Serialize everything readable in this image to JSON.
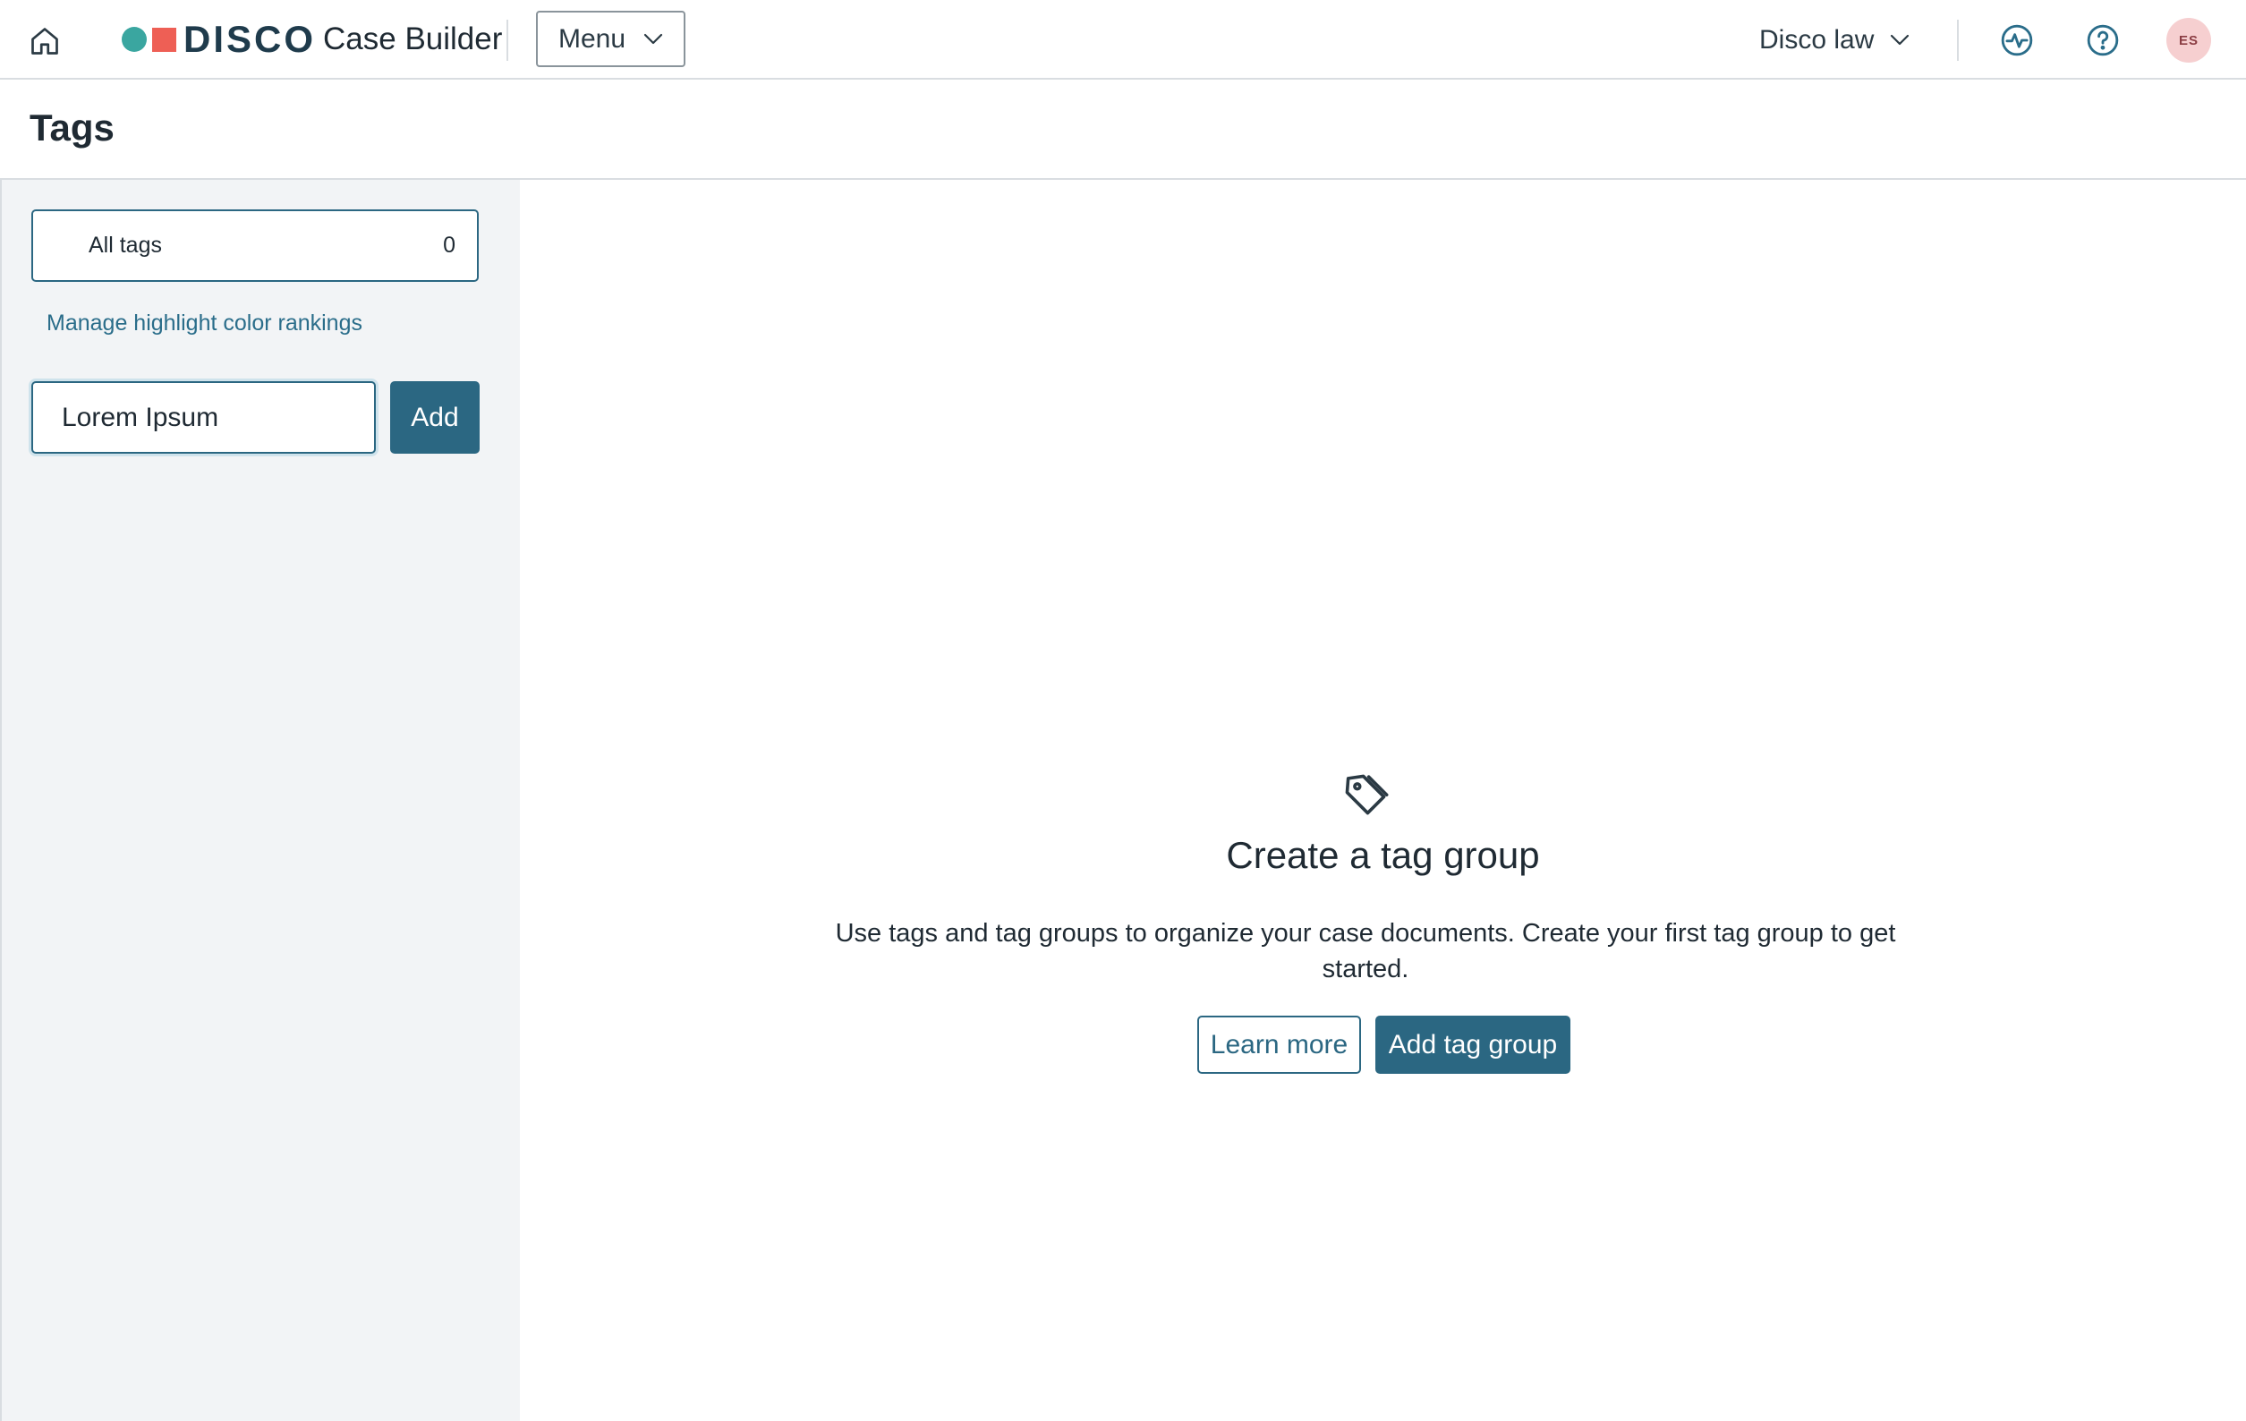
{
  "app": {
    "logo_word": "DISCO",
    "product_name": "Case Builder",
    "brand_colors": {
      "dot": "#3aa6a0",
      "square": "#ee5f55",
      "accent": "#2b6782"
    }
  },
  "topbar": {
    "home_icon": "home-icon",
    "menu_label": "Menu",
    "org_label": "Disco law",
    "activity_icon": "activity-icon",
    "help_icon": "help-icon",
    "avatar_initials": "ES"
  },
  "page": {
    "title": "Tags"
  },
  "sidebar": {
    "all_tags_label": "All tags",
    "all_tags_count": "0",
    "manage_link": "Manage highlight color rankings",
    "new_tag_value": "Lorem Ipsum",
    "add_label": "Add"
  },
  "empty_state": {
    "icon": "tag-icon",
    "title": "Create a tag group",
    "description": "Use tags and tag groups to organize your case documents. Create your first tag group to get started.",
    "learn_more_label": "Learn more",
    "add_group_label": "Add tag group"
  }
}
